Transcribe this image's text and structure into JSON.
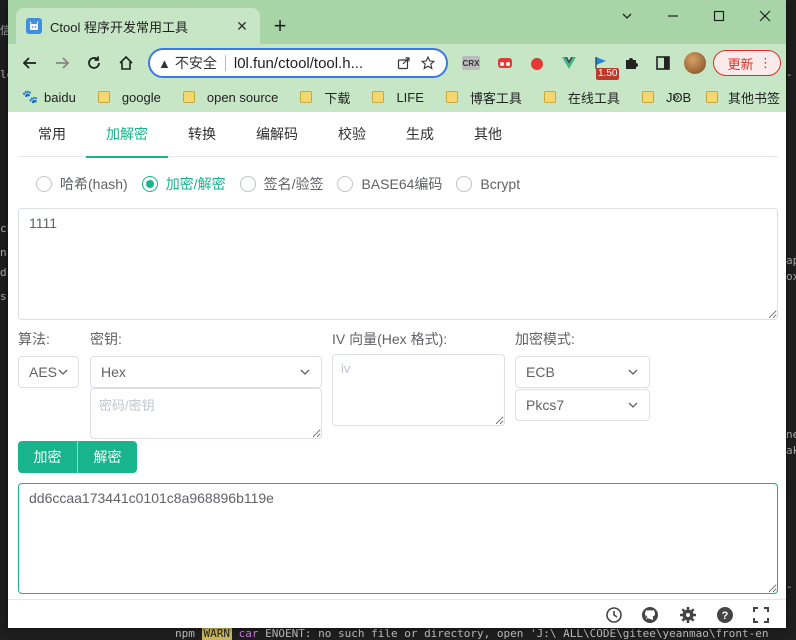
{
  "background": {
    "left_lines": [
      "信",
      "le",
      "ck",
      "n",
      "d",
      "s"
    ],
    "right_lines": [
      "-",
      "ap",
      "ox",
      "ne",
      "ak",
      "-"
    ],
    "terminal_prefix": "npm",
    "terminal_warn": "WARN",
    "terminal_cfg": "car",
    "terminal_text": " ENOENT: no such file or directory, open 'J:\\ ALL\\CODE\\gitee\\yeanmao\\front-en"
  },
  "browser": {
    "tab_title": "Ctool 程序开发常用工具",
    "address": {
      "security_label": "不安全",
      "url": "l0l.fun/ctool/tool.h..."
    },
    "extensions": [
      "crx-icon",
      "extension-red-icon",
      "tomato-icon",
      "vue-devtools-icon",
      "flag-badge-icon",
      "puzzle-icon",
      "sidepanel-icon"
    ],
    "ext_crx_label": "CRX",
    "ext_badge": "1.50",
    "update_label": "更新",
    "bookmarks": [
      {
        "label": "baidu",
        "icon": "paw-icon"
      },
      {
        "label": "google",
        "icon": "folder-icon"
      },
      {
        "label": "open source",
        "icon": "folder-icon"
      },
      {
        "label": "下载",
        "icon": "folder-icon"
      },
      {
        "label": "LIFE",
        "icon": "folder-icon"
      },
      {
        "label": "博客工具",
        "icon": "folder-icon"
      },
      {
        "label": "在线工具",
        "icon": "folder-icon"
      },
      {
        "label": "JOB",
        "icon": "folder-icon"
      }
    ],
    "bookmarks_more": "»",
    "other_bookmarks": "其他书签"
  },
  "app": {
    "tabs": [
      {
        "label": "常用",
        "active": false
      },
      {
        "label": "加解密",
        "active": true
      },
      {
        "label": "转换",
        "active": false
      },
      {
        "label": "编解码",
        "active": false
      },
      {
        "label": "校验",
        "active": false
      },
      {
        "label": "生成",
        "active": false
      },
      {
        "label": "其他",
        "active": false
      }
    ],
    "modes": [
      {
        "label": "哈希(hash)",
        "checked": false
      },
      {
        "label": "加密/解密",
        "checked": true
      },
      {
        "label": "签名/验签",
        "checked": false
      },
      {
        "label": "BASE64编码",
        "checked": false
      },
      {
        "label": "Bcrypt",
        "checked": false
      }
    ],
    "input_value": "1111",
    "algorithm_label": "算法:",
    "algorithm_value": "AES",
    "key_label": "密钥:",
    "key_format": "Hex",
    "key_placeholder": "密码/密钥",
    "iv_label": "IV 向量(Hex 格式):",
    "iv_placeholder": "iv",
    "mode_label": "加密模式:",
    "mode_value": "ECB",
    "padding_value": "Pkcs7",
    "encrypt_label": "加密",
    "decrypt_label": "解密",
    "output_value": "dd6ccaa173441c0101c8a968896b119e",
    "footer_icons": [
      "history-icon",
      "github-icon",
      "settings-icon",
      "help-icon",
      "fullscreen-icon"
    ]
  },
  "colors": {
    "accent": "#18b48c",
    "chrome_frame": "#a8d5a8",
    "chrome_toolbar": "#c6e6c6",
    "update_red": "#d93025"
  }
}
